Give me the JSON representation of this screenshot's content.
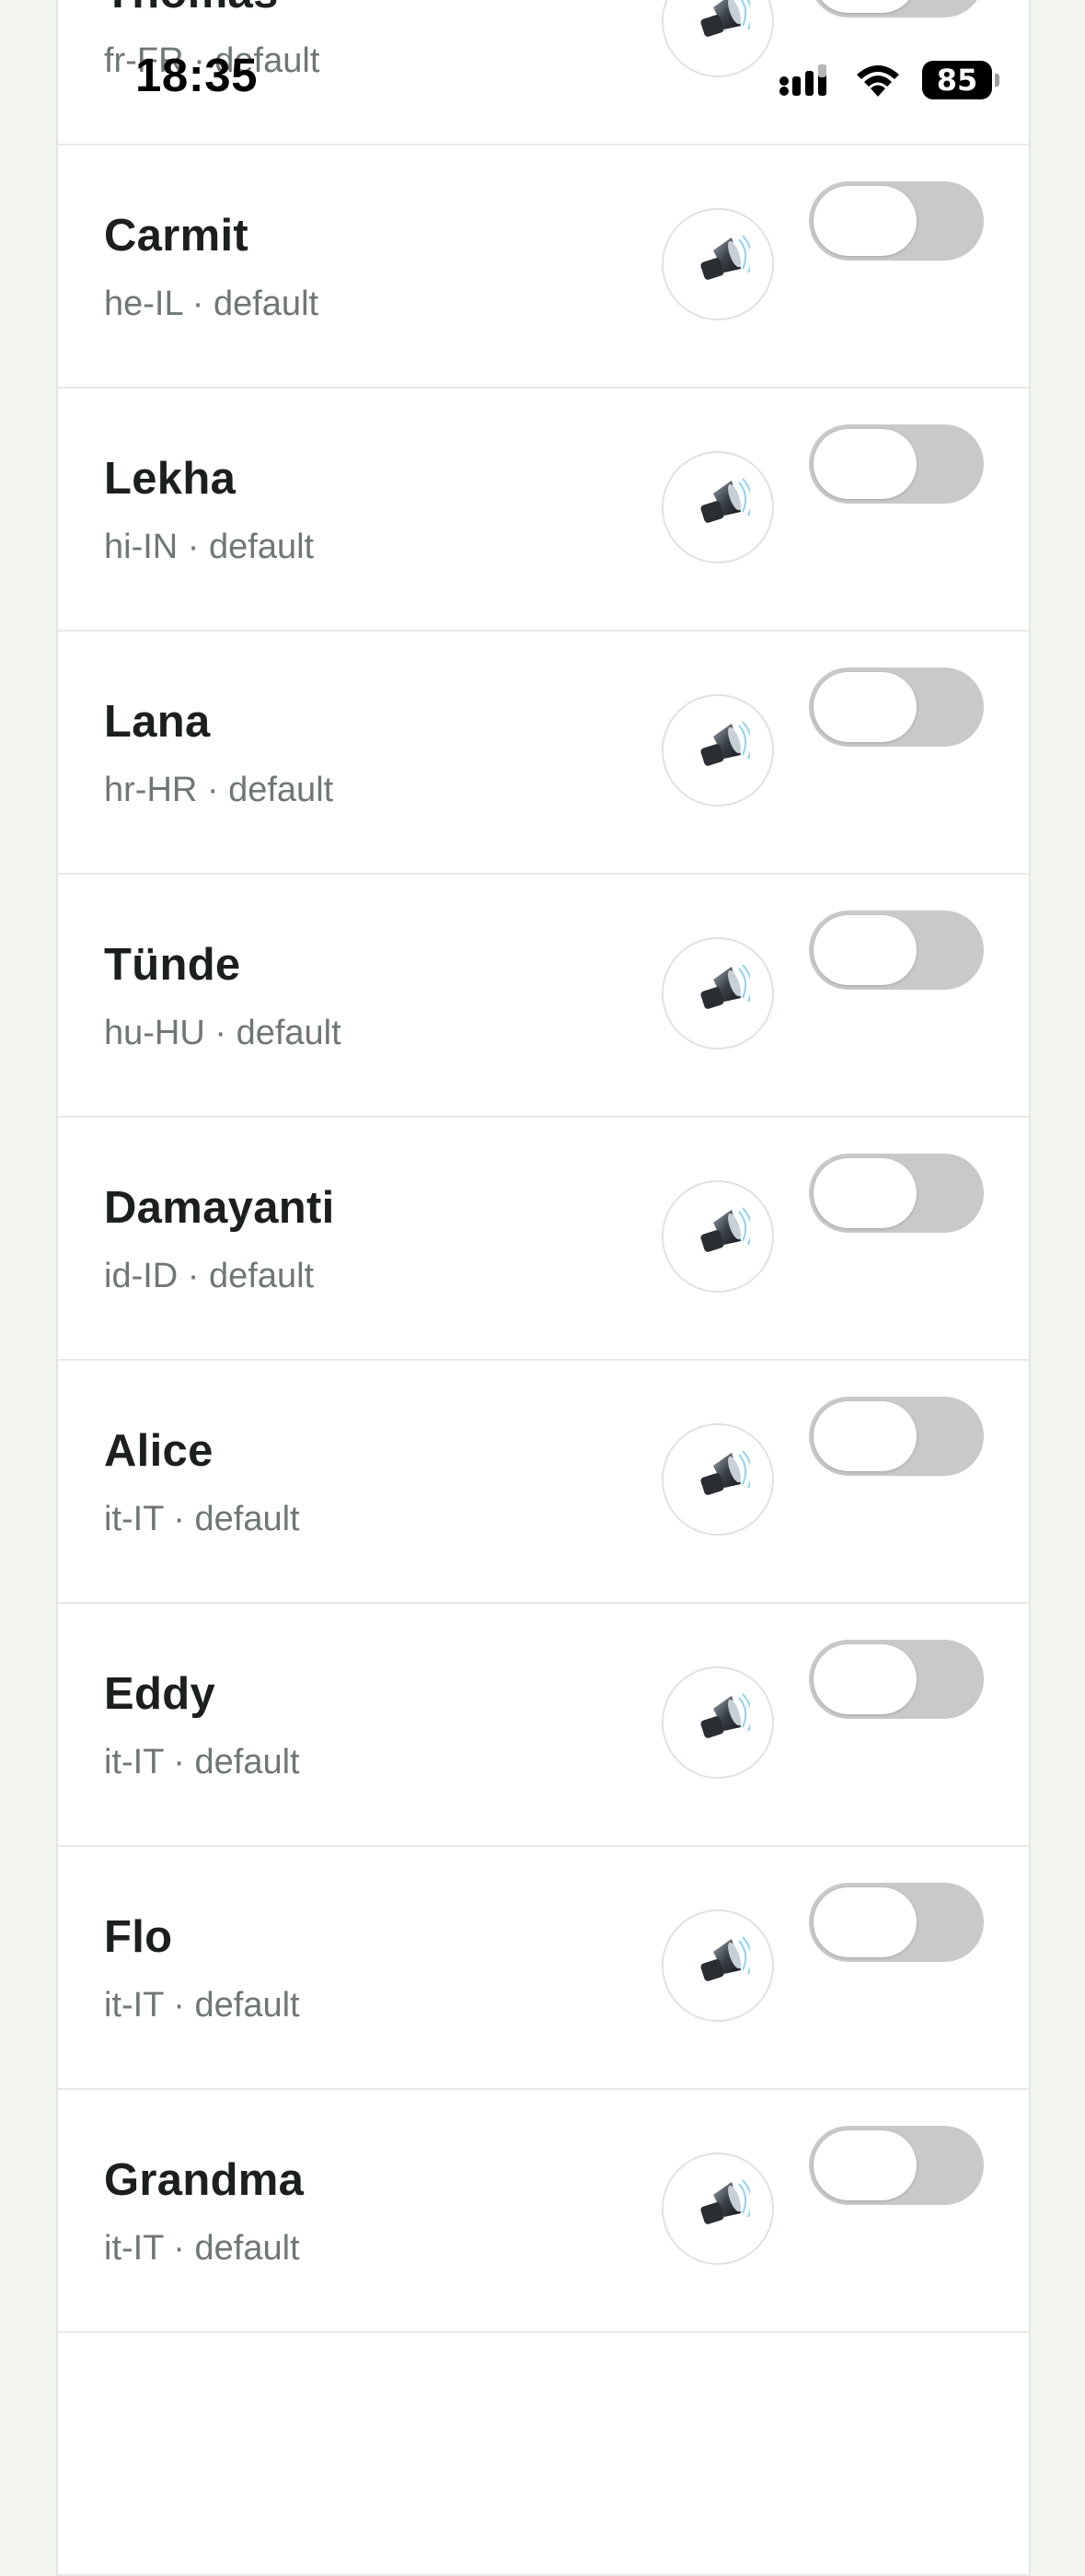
{
  "status_bar": {
    "time": "18:35",
    "battery": "85"
  },
  "voices": [
    {
      "name": "Thomas",
      "meta": "fr-FR · default",
      "enabled": false
    },
    {
      "name": "Carmit",
      "meta": "he-IL · default",
      "enabled": false
    },
    {
      "name": "Lekha",
      "meta": "hi-IN · default",
      "enabled": false
    },
    {
      "name": "Lana",
      "meta": "hr-HR · default",
      "enabled": false
    },
    {
      "name": "Tünde",
      "meta": "hu-HU · default",
      "enabled": false
    },
    {
      "name": "Damayanti",
      "meta": "id-ID · default",
      "enabled": false
    },
    {
      "name": "Alice",
      "meta": "it-IT · default",
      "enabled": false
    },
    {
      "name": "Eddy",
      "meta": "it-IT · default",
      "enabled": false
    },
    {
      "name": "Flo",
      "meta": "it-IT · default",
      "enabled": false
    },
    {
      "name": "Grandma",
      "meta": "it-IT · default",
      "enabled": false
    }
  ],
  "icons": {
    "play": "speaker-icon",
    "signal": "cellular-signal-icon",
    "wifi": "wifi-icon",
    "battery": "battery-icon"
  }
}
